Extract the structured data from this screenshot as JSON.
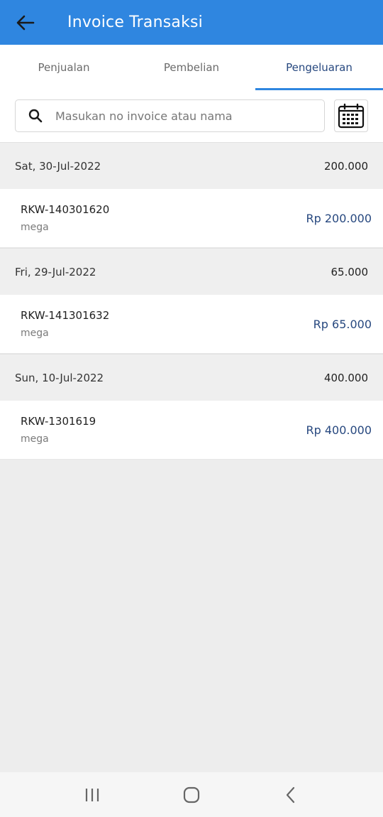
{
  "appbar": {
    "title": "Invoice Transaksi",
    "back_icon": "arrow-left-icon"
  },
  "tabs": [
    {
      "label": "Penjualan",
      "active": false
    },
    {
      "label": "Pembelian",
      "active": false
    },
    {
      "label": "Pengeluaran",
      "active": true
    }
  ],
  "search": {
    "placeholder": "Masukan no invoice atau nama",
    "value": ""
  },
  "groups": [
    {
      "date": "Sat, 30-Jul-2022",
      "total": "200.000",
      "invoice": {
        "no": "RKW-140301620",
        "name": "mega",
        "amount": "Rp 200.000"
      }
    },
    {
      "date": "Fri, 29-Jul-2022",
      "total": "65.000",
      "invoice": {
        "no": "RKW-141301632",
        "name": "mega",
        "amount": "Rp 65.000"
      }
    },
    {
      "date": "Sun, 10-Jul-2022",
      "total": "400.000",
      "invoice": {
        "no": "RKW-1301619",
        "name": "mega",
        "amount": "Rp 400.000"
      }
    }
  ],
  "colors": {
    "primary": "#2f86e0",
    "amount": "#27487f",
    "background": "#ededed"
  }
}
